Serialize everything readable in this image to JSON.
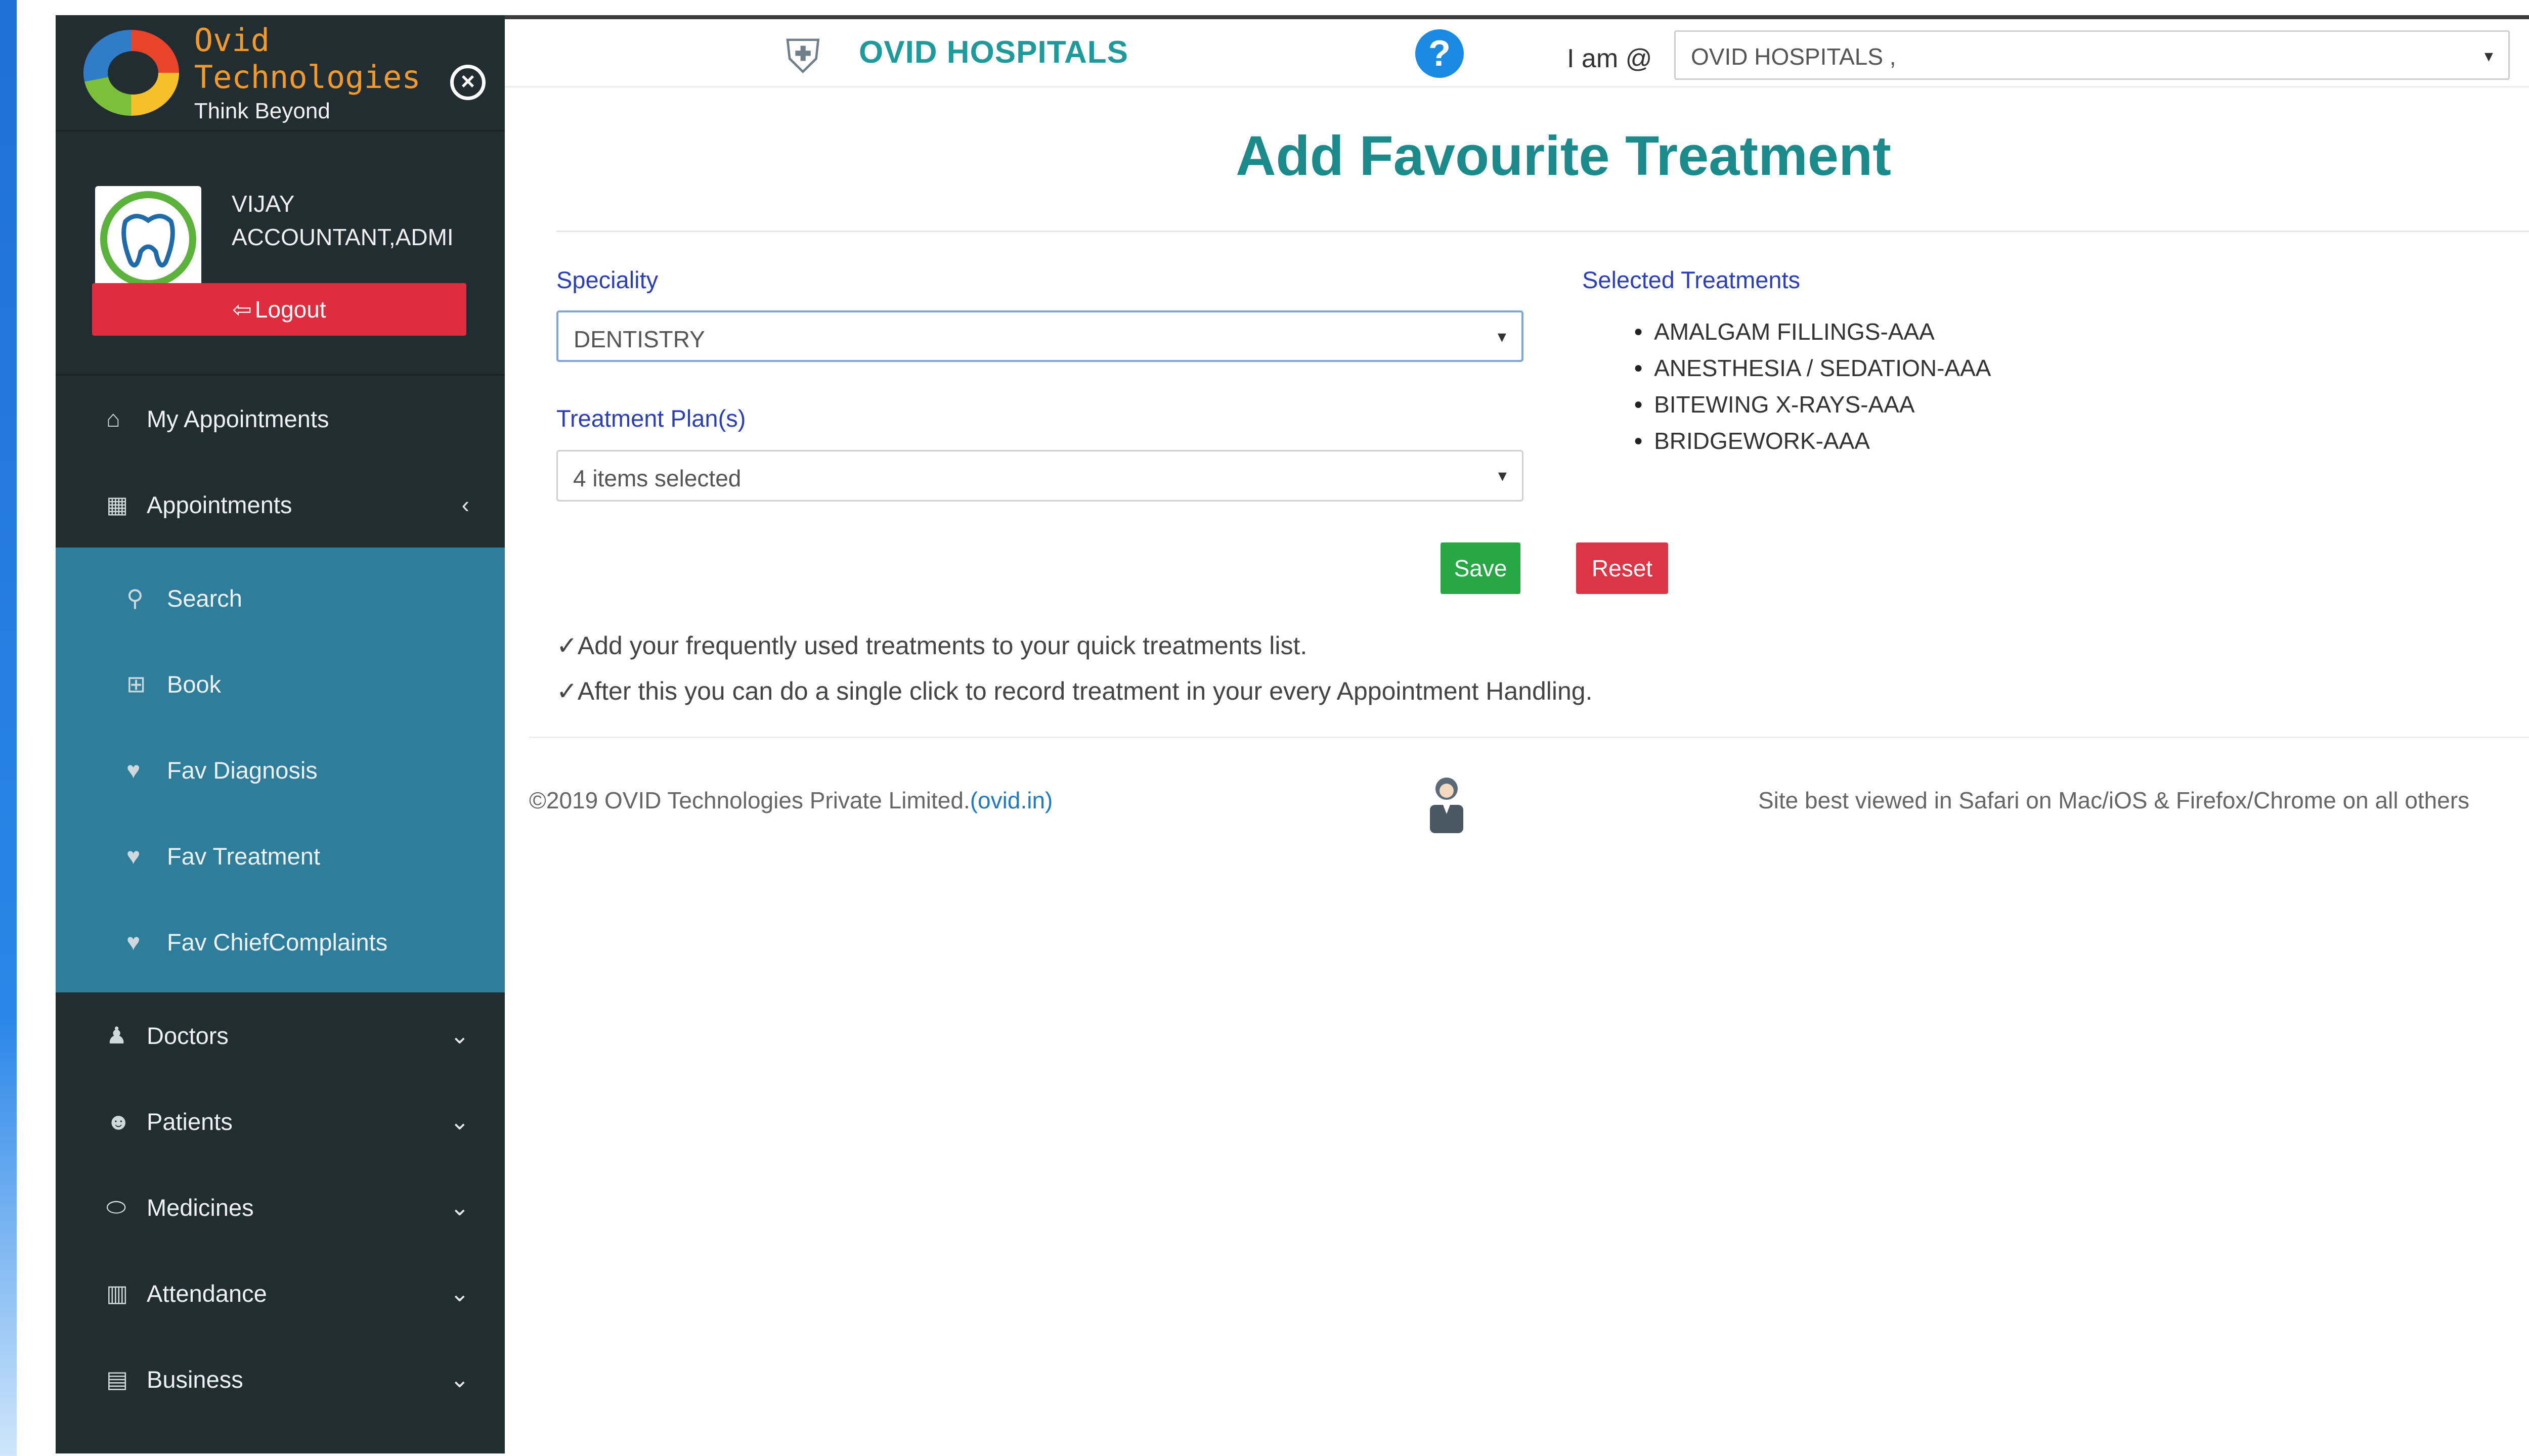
{
  "brand": {
    "name": "Ovid Technologies",
    "tagline": "Think Beyond"
  },
  "user": {
    "name": "VIJAY",
    "role": "ACCOUNTANT,ADMI",
    "logout_label": "Logout"
  },
  "sidebar": {
    "items": [
      {
        "label": "My Appointments",
        "icon": "home-icon"
      },
      {
        "label": "Appointments",
        "icon": "calendar-icon"
      }
    ],
    "submenu": [
      {
        "label": "Search",
        "icon": "search-icon"
      },
      {
        "label": "Book",
        "icon": "plus-square-icon"
      },
      {
        "label": "Fav Diagnosis",
        "icon": "heart-icon"
      },
      {
        "label": "Fav Treatment",
        "icon": "heart-icon"
      },
      {
        "label": "Fav ChiefComplaints",
        "icon": "heart-icon"
      }
    ],
    "lower": [
      {
        "label": "Doctors",
        "icon": "doctor-icon"
      },
      {
        "label": "Patients",
        "icon": "users-icon"
      },
      {
        "label": "Medicines",
        "icon": "pills-icon"
      },
      {
        "label": "Attendance",
        "icon": "book-icon"
      },
      {
        "label": "Business",
        "icon": "clipboard-icon"
      }
    ]
  },
  "header": {
    "title": "OVID HOSPITALS",
    "iam_label": "I am @",
    "org_value": "OVID HOSPITALS ,",
    "help_glyph": "?"
  },
  "main": {
    "page_title": "Add Favourite Treatment",
    "speciality_label": "Speciality",
    "speciality_value": "DENTISTRY",
    "plan_label": "Treatment Plan(s)",
    "plan_value": "4 items selected",
    "selected_label": "Selected Treatments",
    "selected": [
      "AMALGAM FILLINGS-AAA",
      "ANESTHESIA / SEDATION-AAA",
      "BITEWING X-RAYS-AAA",
      "BRIDGEWORK-AAA"
    ],
    "save_label": "Save",
    "reset_label": "Reset",
    "notes": [
      "✓Add your frequently used treatments to your quick treatments list.",
      "✓After this you can do a single click to record treatment in your every Appointment Handling."
    ]
  },
  "footer": {
    "copyright": "©2019 OVID Technologies Private Limited.",
    "link": "(ovid.in)",
    "note": "Site best viewed in Safari on Mac/iOS & Firefox/Chrome on all others"
  },
  "colors": {
    "sidebar": "#222d32",
    "submenu": "#2e7d9a",
    "accent": "#1a8a8a",
    "save": "#28a745",
    "reset": "#dc3545"
  }
}
